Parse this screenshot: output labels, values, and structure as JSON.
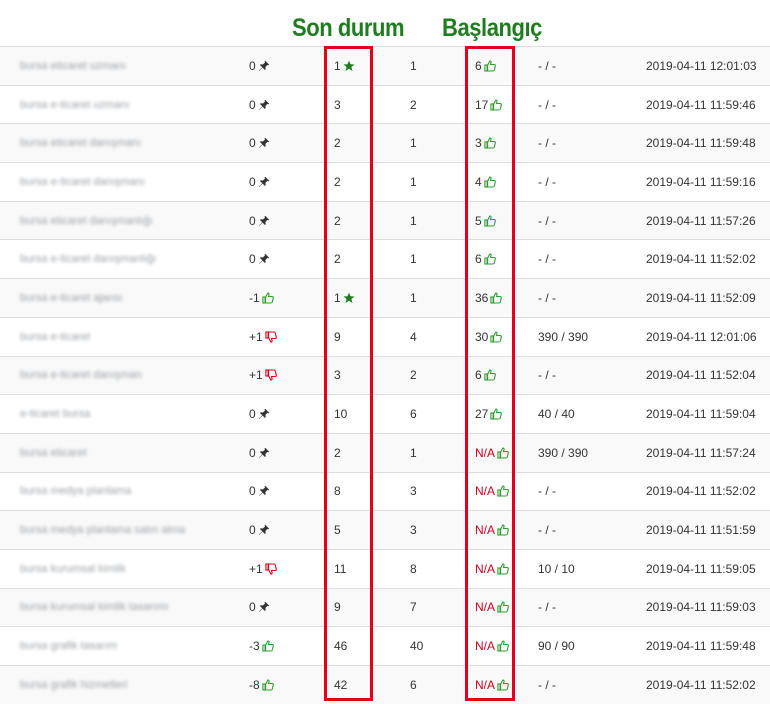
{
  "annotations": {
    "current_status": "Son durum",
    "start_position": "Başlangıç"
  },
  "colors": {
    "annotation_text": "#1f7d1f",
    "highlight_border": "#e3001b",
    "thumb_up": "#2e9d2e",
    "thumb_down": "#d0021b",
    "na_text": "#d0021b",
    "star": "#1f7d1f"
  },
  "rows": [
    {
      "keyword": "bursa eticaret uzmanı",
      "change": "0",
      "change_icon": "pin-icon",
      "current": "1",
      "current_icon": "star-icon",
      "best": "1",
      "start": "6",
      "start_icon": "thumb-up-icon",
      "volume": "- / -",
      "date": "2019-04-11 12:01:03"
    },
    {
      "keyword": "bursa e-ticaret uzmanı",
      "change": "0",
      "change_icon": "pin-icon",
      "current": "3",
      "current_icon": "",
      "best": "2",
      "start": "17",
      "start_icon": "thumb-up-icon",
      "volume": "- / -",
      "date": "2019-04-11 11:59:46"
    },
    {
      "keyword": "bursa eticaret danışmanı",
      "change": "0",
      "change_icon": "pin-icon",
      "current": "2",
      "current_icon": "",
      "best": "1",
      "start": "3",
      "start_icon": "thumb-up-icon",
      "volume": "- / -",
      "date": "2019-04-11 11:59:48"
    },
    {
      "keyword": "bursa e-ticaret danışmanı",
      "change": "0",
      "change_icon": "pin-icon",
      "current": "2",
      "current_icon": "",
      "best": "1",
      "start": "4",
      "start_icon": "thumb-up-icon",
      "volume": "- / -",
      "date": "2019-04-11 11:59:16"
    },
    {
      "keyword": "bursa eticaret danışmanlığı",
      "change": "0",
      "change_icon": "pin-icon",
      "current": "2",
      "current_icon": "",
      "best": "1",
      "start": "5",
      "start_icon": "thumb-up-icon",
      "volume": "- / -",
      "date": "2019-04-11 11:57:26"
    },
    {
      "keyword": "bursa e-ticaret danışmanlığı",
      "change": "0",
      "change_icon": "pin-icon",
      "current": "2",
      "current_icon": "",
      "best": "1",
      "start": "6",
      "start_icon": "thumb-up-icon",
      "volume": "- / -",
      "date": "2019-04-11 11:52:02"
    },
    {
      "keyword": "bursa e-ticaret ajansı",
      "change": "-1",
      "change_icon": "thumb-up-icon",
      "current": "1",
      "current_icon": "star-icon",
      "best": "1",
      "start": "36",
      "start_icon": "thumb-up-icon",
      "volume": "- / -",
      "date": "2019-04-11 11:52:09"
    },
    {
      "keyword": "bursa e-ticaret",
      "change": "+1",
      "change_icon": "thumb-down-icon",
      "current": "9",
      "current_icon": "",
      "best": "4",
      "start": "30",
      "start_icon": "thumb-up-icon",
      "volume": "390 / 390",
      "date": "2019-04-11 12:01:06"
    },
    {
      "keyword": "bursa e-ticaret danışman",
      "change": "+1",
      "change_icon": "thumb-down-icon",
      "current": "3",
      "current_icon": "",
      "best": "2",
      "start": "6",
      "start_icon": "thumb-up-icon",
      "volume": "- / -",
      "date": "2019-04-11 11:52:04"
    },
    {
      "keyword": "e-ticaret bursa",
      "change": "0",
      "change_icon": "pin-icon",
      "current": "10",
      "current_icon": "",
      "best": "6",
      "start": "27",
      "start_icon": "thumb-up-icon",
      "volume": "40 / 40",
      "date": "2019-04-11 11:59:04"
    },
    {
      "keyword": "bursa eticaret",
      "change": "0",
      "change_icon": "pin-icon",
      "current": "2",
      "current_icon": "",
      "best": "1",
      "start": "N/A",
      "start_icon": "thumb-up-icon",
      "volume": "390 / 390",
      "date": "2019-04-11 11:57:24"
    },
    {
      "keyword": "bursa medya planlama",
      "change": "0",
      "change_icon": "pin-icon",
      "current": "8",
      "current_icon": "",
      "best": "3",
      "start": "N/A",
      "start_icon": "thumb-up-icon",
      "volume": "- / -",
      "date": "2019-04-11 11:52:02"
    },
    {
      "keyword": "bursa medya planlama satın alma",
      "change": "0",
      "change_icon": "pin-icon",
      "current": "5",
      "current_icon": "",
      "best": "3",
      "start": "N/A",
      "start_icon": "thumb-up-icon",
      "volume": "- / -",
      "date": "2019-04-11 11:51:59"
    },
    {
      "keyword": "bursa kurumsal kimlik",
      "change": "+1",
      "change_icon": "thumb-down-icon",
      "current": "11",
      "current_icon": "",
      "best": "8",
      "start": "N/A",
      "start_icon": "thumb-up-icon",
      "volume": "10 / 10",
      "date": "2019-04-11 11:59:05"
    },
    {
      "keyword": "bursa kurumsal kimlik tasarımı",
      "change": "0",
      "change_icon": "pin-icon",
      "current": "9",
      "current_icon": "",
      "best": "7",
      "start": "N/A",
      "start_icon": "thumb-up-icon",
      "volume": "- / -",
      "date": "2019-04-11 11:59:03"
    },
    {
      "keyword": "bursa grafik tasarım",
      "change": "-3",
      "change_icon": "thumb-up-icon",
      "current": "46",
      "current_icon": "",
      "best": "40",
      "start": "N/A",
      "start_icon": "thumb-up-icon",
      "volume": "90 / 90",
      "date": "2019-04-11 11:59:48"
    },
    {
      "keyword": "bursa grafik hizmetleri",
      "change": "-8",
      "change_icon": "thumb-up-icon",
      "current": "42",
      "current_icon": "",
      "best": "6",
      "start": "N/A",
      "start_icon": "thumb-up-icon",
      "volume": "- / -",
      "date": "2019-04-11 11:52:02"
    }
  ]
}
